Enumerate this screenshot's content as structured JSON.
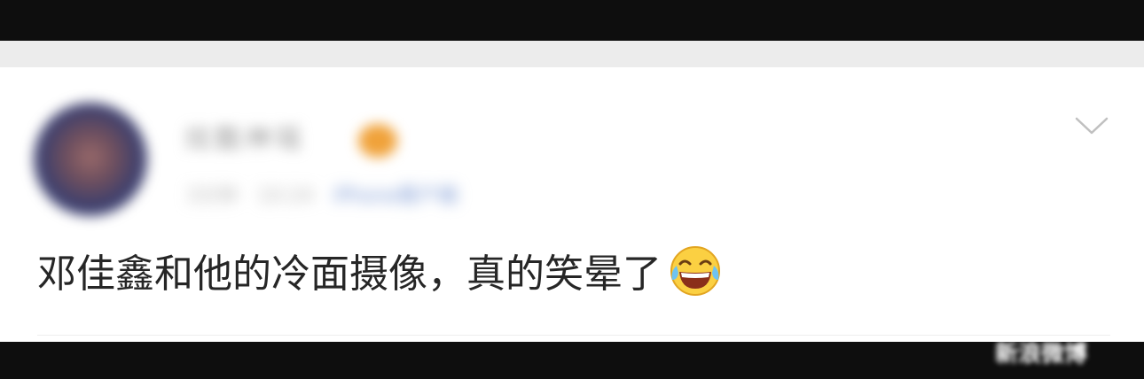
{
  "post": {
    "author": {
      "name": "炫酷神瑶",
      "verified_badge_color": "#f0a23a"
    },
    "meta": {
      "time": "3分钟",
      "date": "10:24",
      "source": "iPhone客户端"
    },
    "content": {
      "text": "邓佳鑫和他的冷面摄像，真的笑晕了",
      "emoji": "laughing-crying-icon"
    }
  },
  "colors": {
    "top_bar": "#0e0e0e",
    "gap_strip": "#ececec",
    "card": "#ffffff",
    "text": "#262626",
    "chevron": "#c0c0c0"
  },
  "watermark": {
    "text": "新浪微博"
  }
}
